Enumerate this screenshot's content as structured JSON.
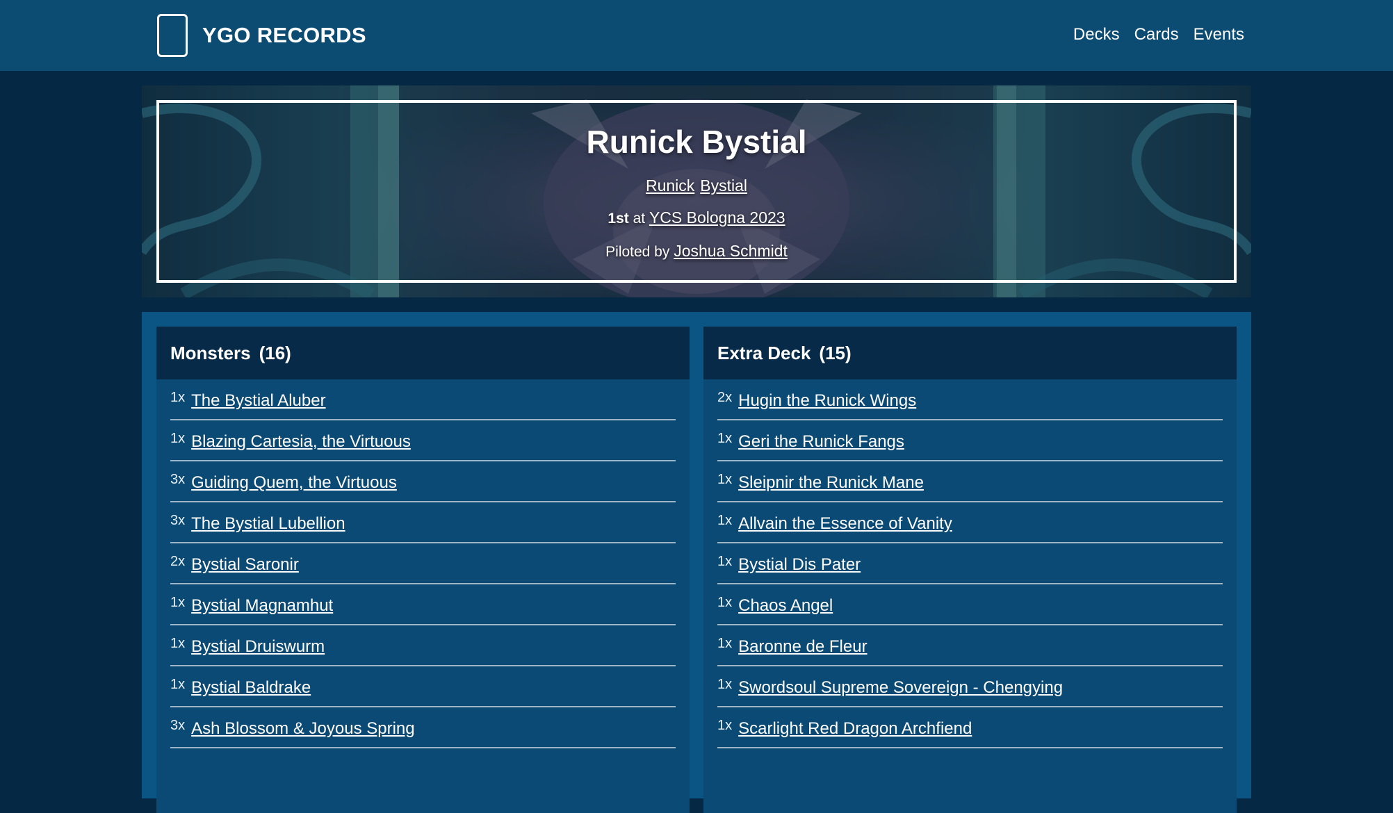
{
  "nav": {
    "brand": "YGO RECORDS",
    "links": [
      "Decks",
      "Cards",
      "Events"
    ]
  },
  "hero": {
    "title": "Runick Bystial",
    "archetypes": [
      "Runick",
      "Bystial"
    ],
    "placement": "1st",
    "placement_connector": "at",
    "event": "YCS Bologna 2023",
    "pilot_prefix": "Piloted by",
    "pilot": "Joshua Schmidt"
  },
  "monsters": {
    "title": "Monsters",
    "count": "(16)",
    "cards": [
      {
        "qty": "1x",
        "name": "The Bystial Aluber"
      },
      {
        "qty": "1x",
        "name": "Blazing Cartesia, the Virtuous"
      },
      {
        "qty": "3x",
        "name": "Guiding Quem, the Virtuous"
      },
      {
        "qty": "3x",
        "name": "The Bystial Lubellion"
      },
      {
        "qty": "2x",
        "name": "Bystial Saronir"
      },
      {
        "qty": "1x",
        "name": "Bystial Magnamhut"
      },
      {
        "qty": "1x",
        "name": "Bystial Druiswurm"
      },
      {
        "qty": "1x",
        "name": "Bystial Baldrake"
      },
      {
        "qty": "3x",
        "name": "Ash Blossom & Joyous Spring"
      }
    ]
  },
  "extra": {
    "title": "Extra Deck",
    "count": "(15)",
    "cards": [
      {
        "qty": "2x",
        "name": "Hugin the Runick Wings"
      },
      {
        "qty": "1x",
        "name": "Geri the Runick Fangs"
      },
      {
        "qty": "1x",
        "name": "Sleipnir the Runick Mane"
      },
      {
        "qty": "1x",
        "name": "Allvain the Essence of Vanity"
      },
      {
        "qty": "1x",
        "name": "Bystial Dis Pater"
      },
      {
        "qty": "1x",
        "name": "Chaos Angel"
      },
      {
        "qty": "1x",
        "name": "Baronne de Fleur"
      },
      {
        "qty": "1x",
        "name": "Swordsoul Supreme Sovereign - Chengying"
      },
      {
        "qty": "1x",
        "name": "Scarlight Red Dragon Archfiend"
      }
    ]
  }
}
